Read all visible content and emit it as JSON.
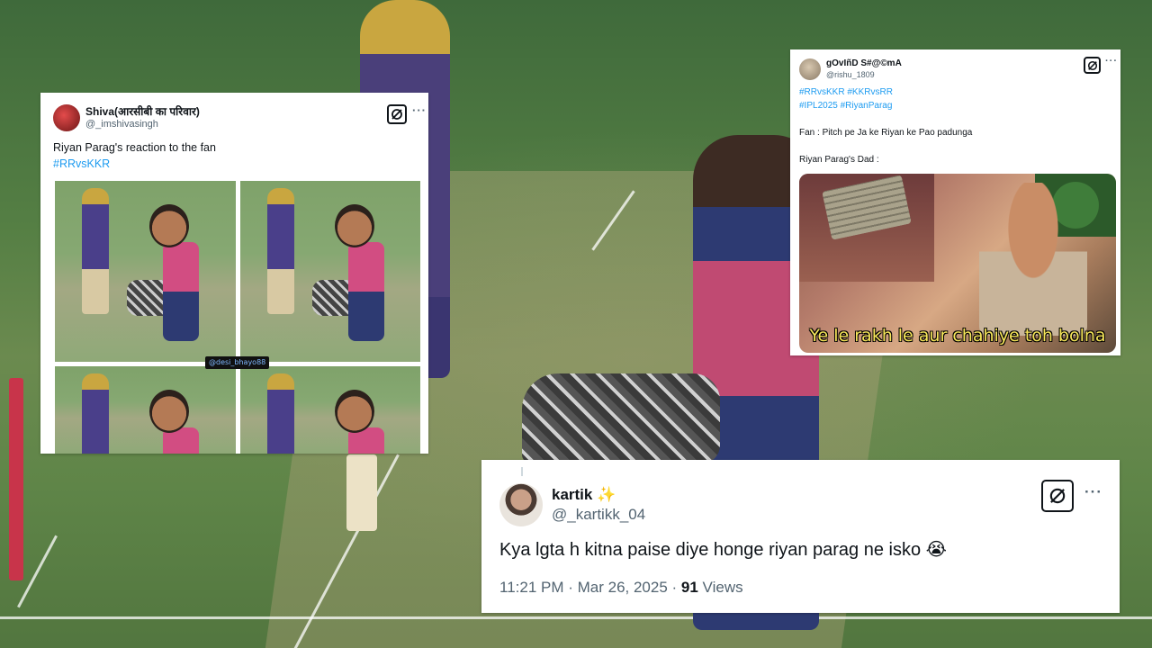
{
  "tweets": [
    {
      "name": "Shiva(आरसीबी का परिवार)",
      "handle": "@_imshivasingh",
      "text": "Riyan Parag's reaction to the fan",
      "hashtags": "#RRvsKKR",
      "watermark": "@desi_bhayo88",
      "avatar_icon": "avatar-image",
      "grok_icon": "grok-icon",
      "more_icon": "more-dots-icon"
    },
    {
      "name": "gOvIñD S#@©mA",
      "handle": "@rishu_1809",
      "hashtags_line1": "#RRvsKKR #KKRvsRR",
      "hashtags_line2": "#IPL2025 #RiyanParag",
      "line_fan": "Fan : Pitch pe Ja ke Riyan ke Pao padunga",
      "line_dad": "Riyan Parag's Dad :",
      "meme_caption": "Ye le rakh le aur chahiye toh bolna"
    },
    {
      "name": "kartik",
      "name_emoji": "✨",
      "handle": "@_kartikk_04",
      "text": "Kya lgta h kitna paise diye honge riyan parag ne isko",
      "text_emoji": "😭",
      "time": "11:21 PM · Mar 26, 2025 · ",
      "views_count": "91",
      "views_label": " Views"
    }
  ],
  "ui": {
    "more_glyph": "···",
    "link_color": "#1d9bf0",
    "text_color": "#0f1419",
    "muted_color": "#536471"
  }
}
